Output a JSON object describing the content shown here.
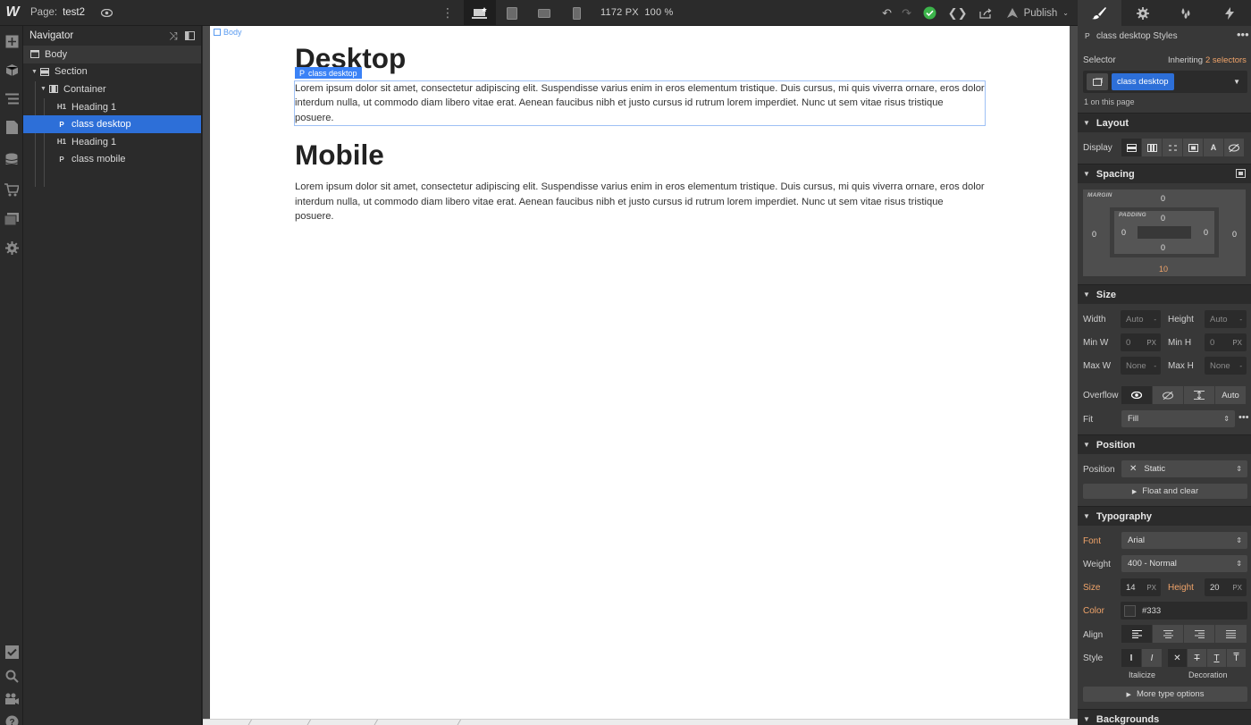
{
  "topbar": {
    "logo": "W",
    "page_label": "Page:",
    "page_name": "test2",
    "viewport_width": "1172 PX",
    "zoom": "100 %",
    "publish_label": "Publish"
  },
  "navigator": {
    "title": "Navigator",
    "items": [
      {
        "icon": "box-icon",
        "label": "Body"
      },
      {
        "icon": "section-icon",
        "label": "Section"
      },
      {
        "icon": "container-icon",
        "label": "Container"
      },
      {
        "icon": "H1",
        "label": "Heading 1"
      },
      {
        "icon": "P",
        "label": "class desktop"
      },
      {
        "icon": "H1",
        "label": "Heading 1"
      },
      {
        "icon": "P",
        "label": "class mobile"
      }
    ]
  },
  "canvas": {
    "body_tag": "Body",
    "selected_tag": "class desktop",
    "selected_tag_prefix": "P",
    "heading1": "Desktop",
    "paragraph1": "Lorem ipsum dolor sit amet, consectetur adipiscing elit. Suspendisse varius enim in eros elementum tristique. Duis cursus, mi quis viverra ornare, eros dolor interdum nulla, ut commodo diam libero vitae erat. Aenean faucibus nibh et justo cursus id rutrum lorem imperdiet. Nunc ut sem vitae risus tristique posuere.",
    "heading2": "Mobile",
    "paragraph2": "Lorem ipsum dolor sit amet, consectetur adipiscing elit. Suspendisse varius enim in eros elementum tristique. Duis cursus, mi quis viverra ornare, eros dolor interdum nulla, ut commodo diam libero vitae erat. Aenean faucibus nibh et justo cursus id rutrum lorem imperdiet. Nunc ut sem vitae risus tristique posuere."
  },
  "style_panel": {
    "header_prefix": "P",
    "header": "class desktop Styles",
    "selector_label": "Selector",
    "inheriting_label": "Inheriting",
    "inheriting_count": "2 selectors",
    "selector_chip": "class desktop",
    "on_page": "1 on this page",
    "layout": {
      "title": "Layout",
      "display_label": "Display"
    },
    "spacing": {
      "title": "Spacing",
      "margin_label": "MARGIN",
      "padding_label": "PADDING",
      "margin_top": "0",
      "margin_left": "0",
      "margin_right": "0",
      "margin_bottom": "10",
      "padding_top": "0",
      "padding_left": "0",
      "padding_right": "0",
      "padding_bottom": "0"
    },
    "size": {
      "title": "Size",
      "width_label": "Width",
      "width_value": "Auto",
      "width_unit": "-",
      "height_label": "Height",
      "height_value": "Auto",
      "height_unit": "-",
      "minw_label": "Min W",
      "minw_value": "0",
      "minw_unit": "PX",
      "minh_label": "Min H",
      "minh_value": "0",
      "minh_unit": "PX",
      "maxw_label": "Max W",
      "maxw_value": "None",
      "maxw_unit": "-",
      "maxh_label": "Max H",
      "maxh_value": "None",
      "maxh_unit": "-",
      "overflow_label": "Overflow",
      "overflow_auto": "Auto",
      "fit_label": "Fit",
      "fit_value": "Fill"
    },
    "position": {
      "title": "Position",
      "position_label": "Position",
      "position_value": "Static",
      "float_clear": "Float and clear"
    },
    "typography": {
      "title": "Typography",
      "font_label": "Font",
      "font_value": "Arial",
      "weight_label": "Weight",
      "weight_value": "400 - Normal",
      "size_label": "Size",
      "size_value": "14",
      "size_unit": "PX",
      "height_label": "Height",
      "height_value": "20",
      "height_unit": "PX",
      "color_label": "Color",
      "color_value": "#333",
      "align_label": "Align",
      "style_label": "Style",
      "italicize_caption": "Italicize",
      "decoration_caption": "Decoration",
      "more_options": "More type options"
    },
    "backgrounds": {
      "title": "Backgrounds"
    }
  },
  "colors": {
    "accent": "#2d6fd8",
    "orange_label": "#f0a46a",
    "success": "#3cb44b"
  }
}
